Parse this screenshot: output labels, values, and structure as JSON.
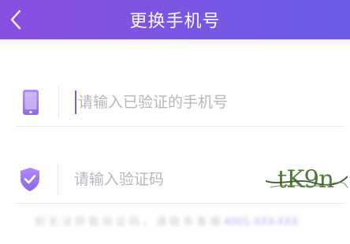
{
  "header": {
    "title": "更换手机号",
    "back_icon": "chevron-left-icon"
  },
  "colors": {
    "header_start": "#8a4ee0",
    "header_end": "#6a5de6",
    "accent": "#7a5bf0",
    "placeholder": "#b7b7bf",
    "divider": "#e9e9ee"
  },
  "phone_field": {
    "icon": "phone-icon",
    "placeholder": "请输入已验证的手机号",
    "value": ""
  },
  "code_field": {
    "icon": "shield-check-icon",
    "placeholder": "请输入验证码",
    "value": "",
    "captcha_text": "tK9n"
  },
  "hint": {
    "text": "如 无 法 获 取 验 证 码 ， 请 联 系 客 服",
    "link": "4001-XXX-XXX"
  }
}
